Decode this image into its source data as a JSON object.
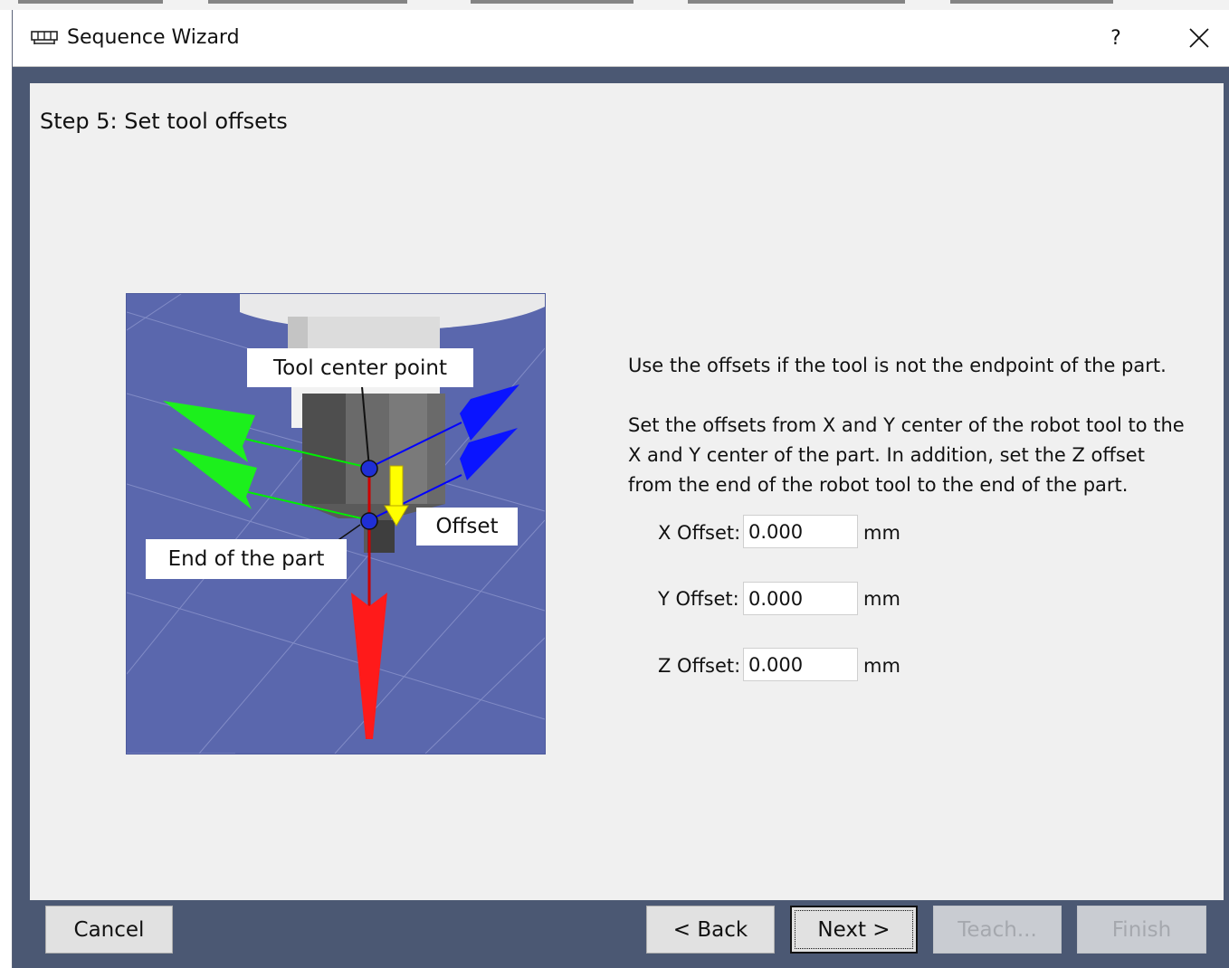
{
  "window": {
    "title": "Sequence Wizard",
    "help_label": "?",
    "app_icon": "wizard-app-icon",
    "close_icon": "close-icon"
  },
  "step": {
    "title": "Step 5: Set tool offsets"
  },
  "diagram": {
    "tool_center_label": "Tool center point",
    "end_label": "End of the part",
    "offset_label": "Offset",
    "colors": {
      "background": "#5a67ad",
      "x_axis": "#00ee00",
      "y_axis": "#0000ff",
      "z_axis": "#ff0000",
      "offset_arrow": "#ffff00"
    }
  },
  "description": {
    "line1": "Use the offsets if the tool is not the endpoint of the part.",
    "line2": "Set the offsets from X and Y center of the robot tool to the",
    "line3": "X and Y center of the part.  In addition, set the Z offset",
    "line4": "from the end of the robot tool to the end of the part."
  },
  "fields": [
    {
      "label": "X Offset:",
      "value": "0.000",
      "unit": "mm"
    },
    {
      "label": "Y Offset:",
      "value": "0.000",
      "unit": "mm"
    },
    {
      "label": "Z Offset:",
      "value": "0.000",
      "unit": "mm"
    }
  ],
  "buttons": {
    "cancel": "Cancel",
    "back": "< Back",
    "next": "Next >",
    "teach": "Teach...",
    "finish": "Finish"
  }
}
